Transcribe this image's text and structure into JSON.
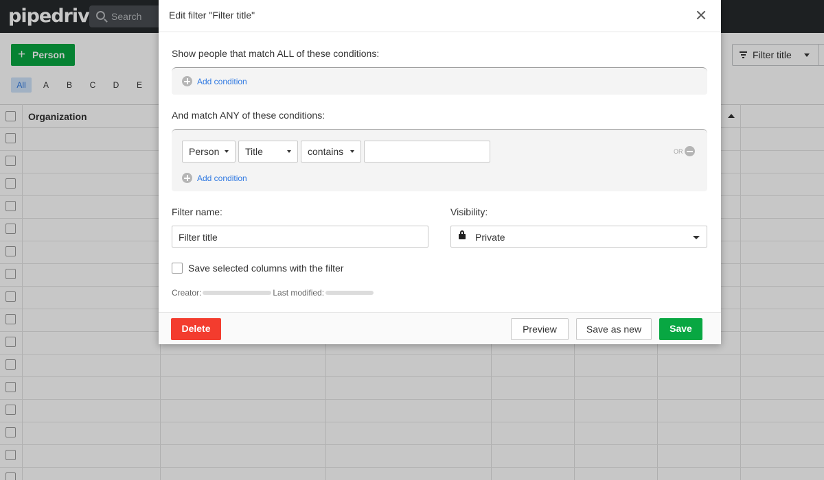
{
  "app": {
    "logo": "pipedrive",
    "search_placeholder": "Search",
    "add_person_label": "Person",
    "letters": [
      "All",
      "A",
      "B",
      "C",
      "D",
      "E"
    ],
    "filter_dropdown_label": "Filter title",
    "table": {
      "first_column": "Organization"
    }
  },
  "modal": {
    "title": "Edit filter \"Filter title\"",
    "all_conditions_label": "Show people that match ALL of these conditions:",
    "any_conditions_label": "And match ANY of these conditions:",
    "add_condition_label": "Add condition",
    "condition": {
      "object": "Person",
      "field": "Title",
      "operator": "contains",
      "value": "",
      "or_label": "OR"
    },
    "filter_name_label": "Filter name:",
    "filter_name_value": "Filter title",
    "visibility_label": "Visibility:",
    "visibility_value": "Private",
    "save_columns_label": "Save selected columns with the filter",
    "creator_label": "Creator:",
    "last_modified_label": "Last modified:",
    "buttons": {
      "delete": "Delete",
      "preview": "Preview",
      "save_as_new": "Save as new",
      "save": "Save"
    }
  },
  "colors": {
    "primary_green": "#08a742",
    "danger_red": "#f33c2e",
    "link_blue": "#317ae2",
    "topbar": "#26292c"
  }
}
